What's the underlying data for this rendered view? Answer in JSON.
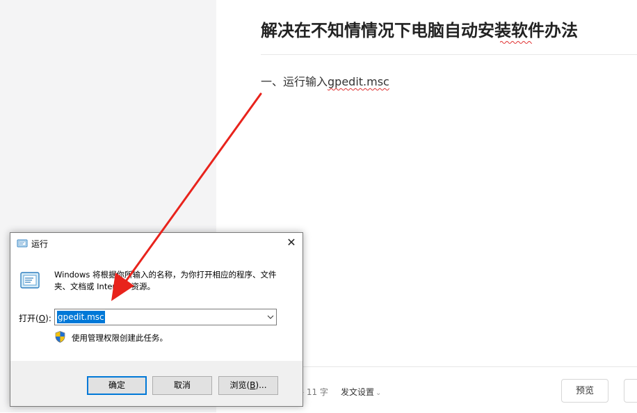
{
  "editor": {
    "title": "解决在不知情情况下电脑自动安装软件办法",
    "body_prefix": "一、运行输入",
    "body_command": "gpedit.msc"
  },
  "bottom_bar": {
    "word_count_text": "共 11 字",
    "publish_settings_label": "发文设置",
    "preview_label": "预览"
  },
  "run_dialog": {
    "title": "运行",
    "description": "Windows 将根据你所输入的名称，为你打开相应的程序、文件夹、文档或 Internet 资源。",
    "open_label": "打开(",
    "open_mnemonic": "O",
    "open_label_end": "):",
    "input_value": "gpedit.msc",
    "admin_note": "使用管理权限创建此任务。",
    "ok_label": "确定",
    "cancel_label": "取消",
    "browse_label": "浏览(",
    "browse_mnemonic": "B",
    "browse_label_end": ")..."
  },
  "colors": {
    "annotation_arrow": "#e8231c",
    "selection": "#0078d7",
    "spell_check_underline": "#e03030"
  },
  "icons": [
    "run-app-icon",
    "close-icon",
    "run-program-icon",
    "chevron-down-icon",
    "uac-shield-icon",
    "arrow-annotation"
  ]
}
